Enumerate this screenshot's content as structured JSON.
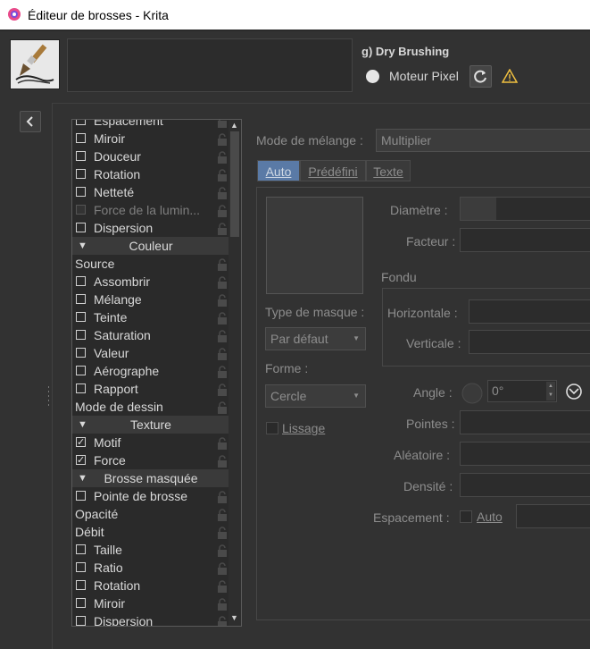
{
  "window": {
    "title": "Éditeur de brosses - Krita"
  },
  "preset": {
    "name": "g) Dry Brushing",
    "engine": "Moteur Pixel"
  },
  "options_list": [
    {
      "label": "Espacement",
      "type": "check",
      "checked": false
    },
    {
      "label": "Miroir",
      "type": "check",
      "checked": false
    },
    {
      "label": "Douceur",
      "type": "check",
      "checked": false
    },
    {
      "label": "Rotation",
      "type": "check",
      "checked": false
    },
    {
      "label": "Netteté",
      "type": "check",
      "checked": false
    },
    {
      "label": "Force de la lumin...",
      "type": "check",
      "checked": false,
      "disabled": true
    },
    {
      "label": "Dispersion",
      "type": "check",
      "checked": false
    },
    {
      "label": "Couleur",
      "type": "header"
    },
    {
      "label": "Source",
      "type": "plain"
    },
    {
      "label": "Assombrir",
      "type": "check",
      "checked": false
    },
    {
      "label": "Mélange",
      "type": "check",
      "checked": false
    },
    {
      "label": "Teinte",
      "type": "check",
      "checked": false
    },
    {
      "label": "Saturation",
      "type": "check",
      "checked": false
    },
    {
      "label": "Valeur",
      "type": "check",
      "checked": false
    },
    {
      "label": "Aérographe",
      "type": "check",
      "checked": false
    },
    {
      "label": "Rapport",
      "type": "check",
      "checked": false
    },
    {
      "label": "Mode de dessin",
      "type": "plain"
    },
    {
      "label": "Texture",
      "type": "header"
    },
    {
      "label": "Motif",
      "type": "check",
      "checked": true
    },
    {
      "label": "Force",
      "type": "check",
      "checked": true
    },
    {
      "label": "Brosse masquée",
      "type": "header"
    },
    {
      "label": "Pointe de brosse",
      "type": "check",
      "checked": false
    },
    {
      "label": "Opacité",
      "type": "plain"
    },
    {
      "label": "Débit",
      "type": "plain"
    },
    {
      "label": "Taille",
      "type": "check",
      "checked": false
    },
    {
      "label": "Ratio",
      "type": "check",
      "checked": false
    },
    {
      "label": "Rotation",
      "type": "check",
      "checked": false
    },
    {
      "label": "Miroir",
      "type": "check",
      "checked": false
    },
    {
      "label": "Dispersion",
      "type": "check",
      "checked": false
    }
  ],
  "blend": {
    "label": "Mode de mélange :",
    "value": "Multiplier"
  },
  "tabs": {
    "auto": "Auto",
    "predefini": "Prédéfini",
    "texte": "Texte"
  },
  "form": {
    "diametre": "Diamètre :",
    "facteur": "Facteur :",
    "fondu": "Fondu",
    "horizontale": "Horizontale :",
    "verticale": "Verticale :",
    "type_masque": "Type de masque :",
    "type_masque_value": "Par défaut",
    "forme": "Forme :",
    "forme_value": "Cercle",
    "angle": "Angle :",
    "angle_value": "0°",
    "lissage": "Lissage",
    "pointes": "Pointes :",
    "aleatoire": "Aléatoire :",
    "densite": "Densité :",
    "espacement": "Espacement :",
    "auto": "Auto"
  },
  "colors": {
    "accent": "#5a7aa6",
    "background": "#323232",
    "list_bg": "#2a2a2a",
    "warning": "#f0c040"
  }
}
